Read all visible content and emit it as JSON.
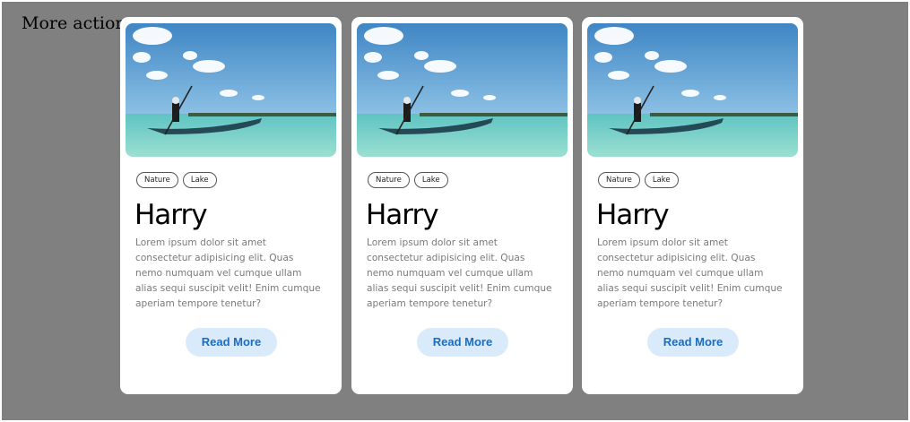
{
  "page": {
    "heading": "More actions"
  },
  "cards": [
    {
      "image": "photo of a person poling a wooden canoe on turquoise water under a blue sky",
      "tags": [
        "Nature",
        "Lake"
      ],
      "title": "Harry",
      "text": "Lorem ipsum dolor sit amet\nconsectetur adipisicing elit. Quas\nnemo numquam vel cumque ullam\nalias sequi suscipit velit! Enim cumque\naperiam tempore tenetur?",
      "button_label": "Read More"
    },
    {
      "image": "photo of a person poling a wooden canoe on turquoise water under a blue sky",
      "tags": [
        "Nature",
        "Lake"
      ],
      "title": "Harry",
      "text": "Lorem ipsum dolor sit amet\nconsectetur adipisicing elit. Quas\nnemo numquam vel cumque ullam\nalias sequi suscipit velit! Enim cumque\naperiam tempore tenetur?",
      "button_label": "Read More"
    },
    {
      "image": "photo of a person poling a wooden canoe on turquoise water under a blue sky",
      "tags": [
        "Nature",
        "Lake"
      ],
      "title": "Harry",
      "text": "Lorem ipsum dolor sit amet\nconsectetur adipisicing elit. Quas\nnemo numquam vel cumque ullam\nalias sequi suscipit velit! Enim cumque\naperiam tempore tenetur?",
      "button_label": "Read More"
    }
  ],
  "colors": {
    "backdrop": "#808080",
    "card": "#ffffff",
    "button_bg": "#d9ebfb",
    "button_text": "#1a6dc4",
    "body_text": "#7a7a7a"
  }
}
